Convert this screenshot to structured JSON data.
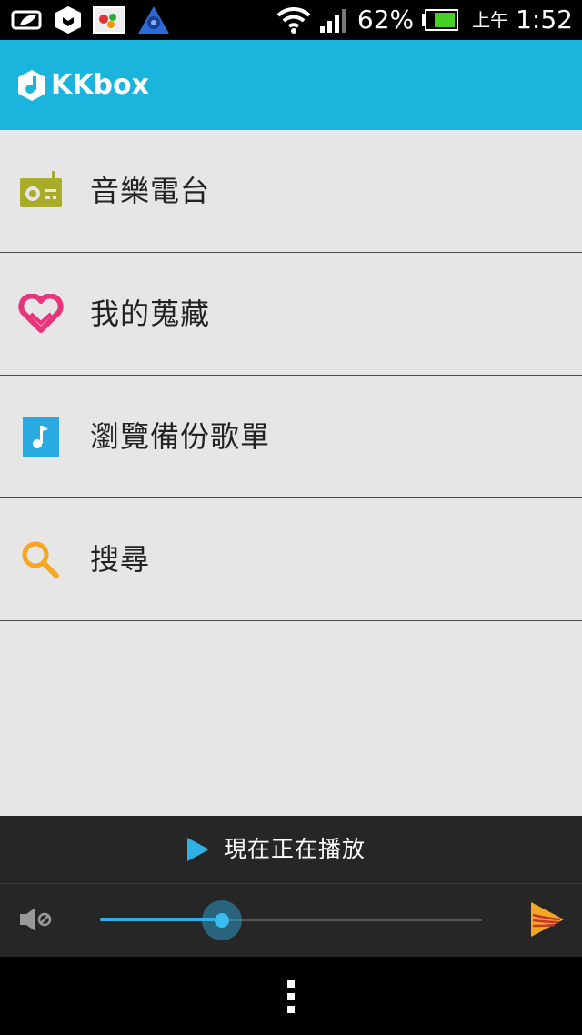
{
  "status_bar": {
    "battery_percent": "62%",
    "ampm": "上午",
    "time": "1:52",
    "icons": [
      "kkbox-notification-icon",
      "hexagon-app-icon",
      "photo-app-icon",
      "triangle-app-icon",
      "wifi-icon",
      "signal-icon",
      "battery-icon"
    ]
  },
  "app_bar": {
    "logo_text": "KKbox"
  },
  "menu": {
    "items": [
      {
        "label": "音樂電台",
        "icon": "radio-icon",
        "color": "#a8ac2a"
      },
      {
        "label": "我的蒐藏",
        "icon": "heart-icon",
        "color": "#e8347a"
      },
      {
        "label": "瀏覽備份歌單",
        "icon": "music-note-icon",
        "color": "#29abe2"
      },
      {
        "label": "搜尋",
        "icon": "search-icon",
        "color": "#f5a623"
      }
    ]
  },
  "now_playing": {
    "label": "現在正在播放"
  },
  "player": {
    "volume_fraction": 0.32
  },
  "colors": {
    "accent": "#1ab4dc",
    "slider": "#2fb0e6",
    "background": "#e6e6e6",
    "dark_bar": "#262626"
  }
}
